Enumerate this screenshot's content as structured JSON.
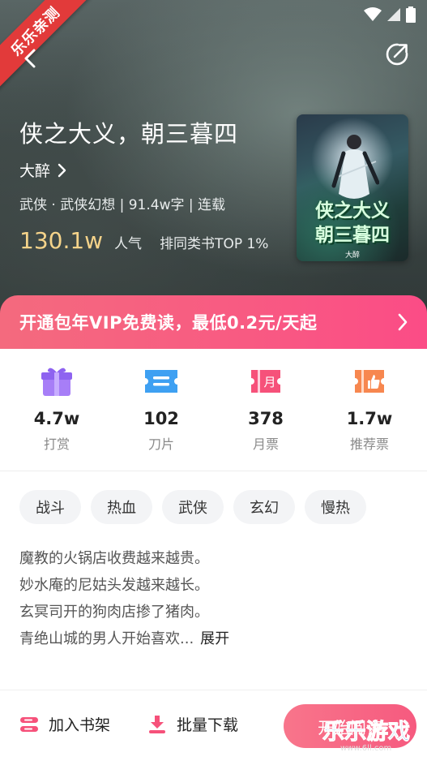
{
  "colors": {
    "accent_pink": "#f85b82",
    "popularity_gold": "#f5d38a",
    "corner_banner_red": "#e23a3a",
    "watermark_blue": "#2a8be0"
  },
  "corner_banner": {
    "text": "乐乐亲测"
  },
  "header": {
    "back_icon": "chevron-left-icon",
    "share_icon": "share-icon"
  },
  "book": {
    "title": "侠之大义，朝三暮四",
    "author": "大醉",
    "meta": "武侠 · 武侠幻想 | 91.4w字 | 连载",
    "popularity_value": "130.1w",
    "popularity_label": "人气",
    "rank_text": "排同类书TOP 1%",
    "cover_title_line1": "侠之大义",
    "cover_title_line2": "朝三暮四",
    "cover_author": "大醉"
  },
  "vip_banner": {
    "text": "开通包年VIP免费读，最低0.2元/天起"
  },
  "stats": [
    {
      "value": "4.7w",
      "label": "打赏",
      "icon": "gift-icon"
    },
    {
      "value": "102",
      "label": "刀片",
      "icon": "ticket-icon"
    },
    {
      "value": "378",
      "label": "月票",
      "icon": "monthly-ticket-icon"
    },
    {
      "value": "1.7w",
      "label": "推荐票",
      "icon": "thumbs-up-ticket-icon"
    }
  ],
  "tags": [
    "战斗",
    "热血",
    "武侠",
    "玄幻",
    "慢热"
  ],
  "description": {
    "lines": [
      "魔教的火锅店收费越来越贵。",
      "妙水庵的尼姑头发越来越长。",
      "玄冥司开的狗肉店掺了猪肉。",
      "青绝山城的男人开始喜欢..."
    ],
    "expand_label": "展开"
  },
  "bottom_bar": {
    "add_shelf_label": "加入书架",
    "download_label": "批量下载",
    "read_label": "开始阅读"
  },
  "watermark": {
    "text": "乐乐游戏",
    "url": "www.6ll.com"
  }
}
